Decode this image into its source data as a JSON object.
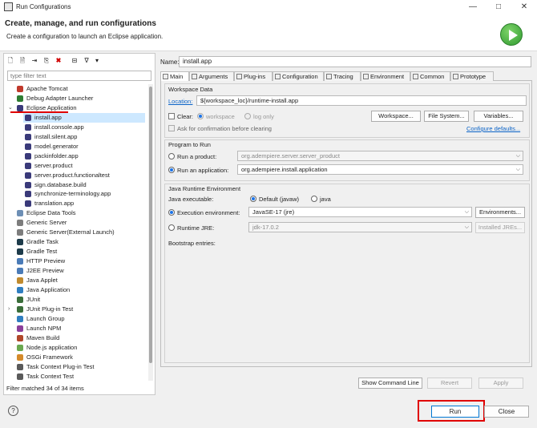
{
  "window": {
    "title": "Run Configurations"
  },
  "header": {
    "title": "Create, manage, and run configurations",
    "subtitle": "Create a configuration to launch an Eclipse application."
  },
  "left": {
    "filter_placeholder": "type filter text",
    "status": "Filter matched 34 of 34 items",
    "tree": [
      {
        "label": "Apache Tomcat",
        "icon": "tomcat-icon",
        "color": "#c0392b",
        "level": 0
      },
      {
        "label": "Debug Adapter Launcher",
        "icon": "debug-adapter-icon",
        "color": "#2e7d32",
        "level": 0
      },
      {
        "label": "Eclipse Application",
        "icon": "eclipse-icon",
        "color": "#3a3a7a",
        "level": 0,
        "expanded": true
      },
      {
        "label": "install.app",
        "icon": "eclipse-icon",
        "color": "#3a3a7a",
        "level": 1,
        "selected": true
      },
      {
        "label": "install.console.app",
        "icon": "eclipse-icon",
        "color": "#3a3a7a",
        "level": 1
      },
      {
        "label": "install.silent.app",
        "icon": "eclipse-icon",
        "color": "#3a3a7a",
        "level": 1
      },
      {
        "label": "model.generator",
        "icon": "eclipse-icon",
        "color": "#3a3a7a",
        "level": 1
      },
      {
        "label": "packinfolder.app",
        "icon": "eclipse-icon",
        "color": "#3a3a7a",
        "level": 1
      },
      {
        "label": "server.product",
        "icon": "eclipse-icon",
        "color": "#3a3a7a",
        "level": 1
      },
      {
        "label": "server.product.functionaltest",
        "icon": "eclipse-icon",
        "color": "#3a3a7a",
        "level": 1
      },
      {
        "label": "sign.database.build",
        "icon": "eclipse-icon",
        "color": "#3a3a7a",
        "level": 1
      },
      {
        "label": "synchronize-terminology.app",
        "icon": "eclipse-icon",
        "color": "#3a3a7a",
        "level": 1
      },
      {
        "label": "translation.app",
        "icon": "eclipse-icon",
        "color": "#3a3a7a",
        "level": 1
      },
      {
        "label": "Eclipse Data Tools",
        "icon": "data-tools-icon",
        "color": "#6d8fb5",
        "level": 0
      },
      {
        "label": "Generic Server",
        "icon": "server-icon",
        "color": "#7d7d7d",
        "level": 0
      },
      {
        "label": "Generic Server(External Launch)",
        "icon": "server-icon",
        "color": "#7d7d7d",
        "level": 0
      },
      {
        "label": "Gradle Task",
        "icon": "gradle-icon",
        "color": "#1d3b4a",
        "level": 0
      },
      {
        "label": "Gradle Test",
        "icon": "gradle-icon",
        "color": "#1d3b4a",
        "level": 0
      },
      {
        "label": "HTTP Preview",
        "icon": "http-icon",
        "color": "#4a7bb7",
        "level": 0
      },
      {
        "label": "J2EE Preview",
        "icon": "j2ee-icon",
        "color": "#4a7bb7",
        "level": 0
      },
      {
        "label": "Java Applet",
        "icon": "java-applet-icon",
        "color": "#c08a2e",
        "level": 0
      },
      {
        "label": "Java Application",
        "icon": "java-app-icon",
        "color": "#2f7ec0",
        "level": 0
      },
      {
        "label": "JUnit",
        "icon": "junit-icon",
        "color": "#3a6e3a",
        "level": 0
      },
      {
        "label": "JUnit Plug-in Test",
        "icon": "junit-plugin-icon",
        "color": "#3a6e3a",
        "level": 0,
        "collapsed": true
      },
      {
        "label": "Launch Group",
        "icon": "launch-group-icon",
        "color": "#2f7ec0",
        "level": 0
      },
      {
        "label": "Launch NPM",
        "icon": "npm-icon",
        "color": "#8a3f9a",
        "level": 0
      },
      {
        "label": "Maven Build",
        "icon": "maven-icon",
        "color": "#b0472a",
        "level": 0
      },
      {
        "label": "Node.js application",
        "icon": "nodejs-icon",
        "color": "#6aa84f",
        "level": 0
      },
      {
        "label": "OSGi Framework",
        "icon": "osgi-icon",
        "color": "#d48a2a",
        "level": 0
      },
      {
        "label": "Task Context Plug-in Test",
        "icon": "task-icon",
        "color": "#5a5a5a",
        "level": 0
      },
      {
        "label": "Task Context Test",
        "icon": "task-icon",
        "color": "#5a5a5a",
        "level": 0
      }
    ]
  },
  "right": {
    "name_label": "Name:",
    "name_value": "install.app",
    "tabs": [
      "Main",
      "Arguments",
      "Plug-ins",
      "Configuration",
      "Tracing",
      "Environment",
      "Common",
      "Prototype"
    ],
    "workspace": {
      "title": "Workspace Data",
      "location_label": "Location:",
      "location_value": "${workspace_loc}/runtime-install.app",
      "clear_label": "Clear:",
      "workspace_radio": "workspace",
      "log_radio": "log only",
      "workspace_btn": "Workspace...",
      "filesystem_btn": "File System...",
      "variables_btn": "Variables...",
      "ask_label": "Ask for confirmation before clearing",
      "configure_link": "Configure defaults..."
    },
    "program": {
      "title": "Program to Run",
      "product_label": "Run a product:",
      "product_value": "org.adempiere.server.server_product",
      "application_label": "Run an application:",
      "application_value": "org.adempiere.install.application"
    },
    "jre": {
      "title": "Java Runtime Environment",
      "executable_label": "Java executable:",
      "default_label": "Default (javaw)",
      "java_label": "java",
      "exec_env_label": "Execution environment:",
      "exec_env_value": "JavaSE-17 (jre)",
      "environments_btn": "Environments...",
      "runtime_jre_label": "Runtime JRE:",
      "runtime_jre_value": "jdk-17.0.2",
      "installed_jres_btn": "Installed JREs...",
      "bootstrap_label": "Bootstrap entries:"
    },
    "show_command_line": "Show Command Line",
    "revert": "Revert",
    "apply": "Apply"
  },
  "footer": {
    "help": "?",
    "run": "Run",
    "close": "Close"
  }
}
